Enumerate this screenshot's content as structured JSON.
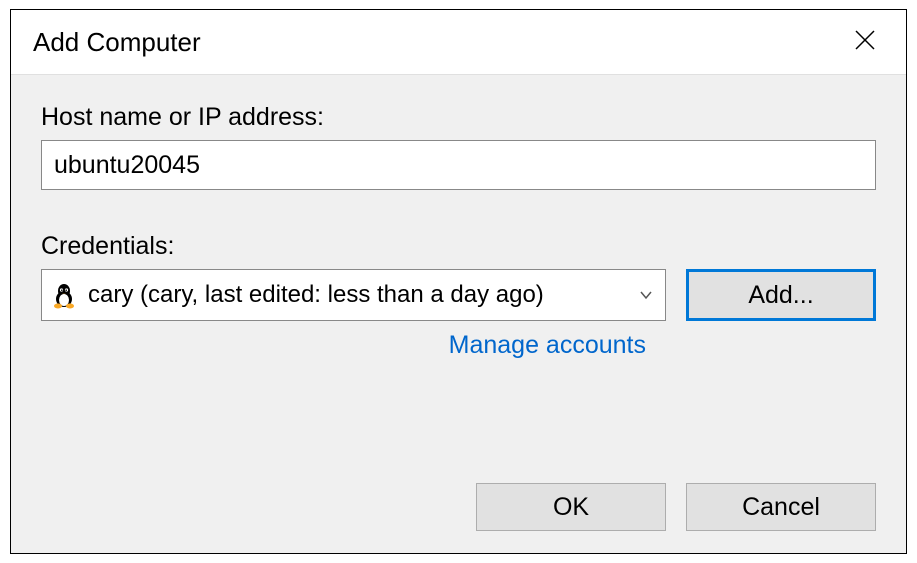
{
  "dialog": {
    "title": "Add Computer"
  },
  "hostname": {
    "label": "Host name or IP address:",
    "value": "ubuntu20045"
  },
  "credentials": {
    "label": "Credentials:",
    "selected": "cary (cary, last edited: less than a day ago)",
    "icon": "linux-tux-icon",
    "add_button": "Add...",
    "manage_link": "Manage accounts"
  },
  "buttons": {
    "ok": "OK",
    "cancel": "Cancel"
  }
}
